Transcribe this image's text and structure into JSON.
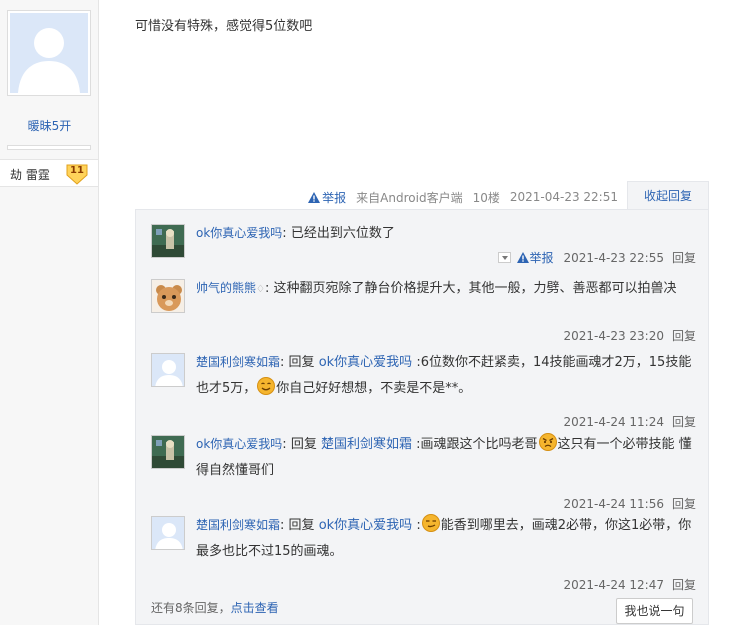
{
  "author": {
    "name": "暖昧5开",
    "level_name": "劫 雷霆",
    "level_num": "11"
  },
  "post": {
    "text": "可惜没有特殊，感觉得5位数吧",
    "report_label": "举报",
    "client": "来自Android客户端",
    "floor": "10楼",
    "time": "2021-04-23 22:51",
    "collapse_label": "收起回复"
  },
  "replies": [
    {
      "name": "ok你真心爱我吗",
      "reply_word": "",
      "to": "",
      "text": "已经出到六位数了",
      "text2": "",
      "text3": "",
      "report_label": "举报",
      "time": "2021-4-23 22:55",
      "reply_label": "回复"
    },
    {
      "name": "帅气的熊熊",
      "text": "这种翻页宛除了静台价格提升大，其他一般，力劈、善恶都可以拍兽决",
      "time": "2021-4-23 23:20",
      "reply_label": "回复"
    },
    {
      "name": "楚国利剑寒如霜",
      "reply_word": "回复",
      "to": "ok你真心爱我吗",
      "text": ":6位数你不赶紧卖，14技能画魂才2万，15技能也才5万，",
      "text2": "你自己好好想想，不卖是不是**。",
      "time": "2021-4-24 11:24",
      "reply_label": "回复"
    },
    {
      "name": "ok你真心爱我吗",
      "reply_word": "回复",
      "to": "楚国利剑寒如霜",
      "text": ":画魂跟这个比吗老哥",
      "text2": "这只有一个必带技能 懂得自然懂哥们",
      "time": "2021-4-24 11:56",
      "reply_label": "回复"
    },
    {
      "name": "楚国利剑寒如霜",
      "reply_word": "回复",
      "to": "ok你真心爱我吗",
      "text": ":",
      "text2": "能香到哪里去，画魂2必带，你这1必带，你最多也比不过15的画魂。",
      "time": "2021-4-24 12:47",
      "reply_label": "回复"
    }
  ],
  "footer": {
    "more_text": "还有8条回复，",
    "more_link": "点击查看",
    "say_label": "我也说一句"
  }
}
